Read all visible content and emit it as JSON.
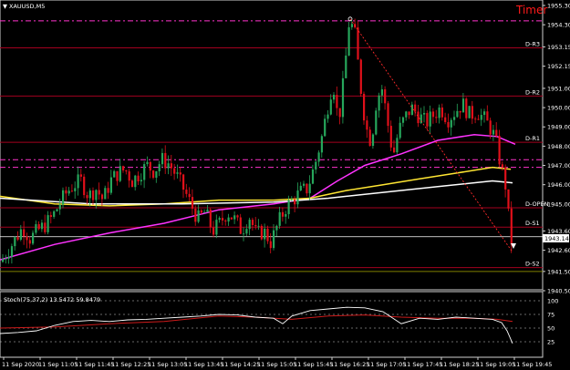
{
  "window": {
    "title": "XAUUSD,M5",
    "timer": "Timer"
  },
  "indicator": {
    "label": "Stoch(75,37,2) 13.5472 59.8479"
  },
  "colors": {
    "bull": "#26a65b",
    "bear": "#e0101a",
    "magenta": "#ff33ff",
    "yellow": "#ffe633",
    "white": "#ffffff",
    "pivot": "#a3001e",
    "dash": "#ff33cc",
    "stoch_main": "#ffffff",
    "stoch_signal": "#cc1a1a",
    "olive": "#808000"
  },
  "chart_data": {
    "type": "candlestick",
    "y_ticks": [
      "1955.30",
      "1954.30",
      "1953.15",
      "1952.15",
      "1951.00",
      "1950.00",
      "1949.00",
      "1948.00",
      "1947.00",
      "1946.00",
      "1945.00",
      "1943.60",
      "1942.60",
      "1941.50",
      "1940.50"
    ],
    "current_price": "1943.14",
    "x_ticks": [
      "11 Sep 2020",
      "11 Sep 11:05",
      "11 Sep 11:45",
      "11 Sep 12:25",
      "11 Sep 13:05",
      "11 Sep 13:45",
      "11 Sep 14:25",
      "11 Sep 15:05",
      "11 Sep 15:45",
      "11 Sep 16:25",
      "11 Sep 17:05",
      "11 Sep 17:45",
      "11 Sep 18:25",
      "11 Sep 19:05",
      "11 Sep 19:45"
    ],
    "pivots": [
      {
        "name": "D-R3",
        "price": 1953.1
      },
      {
        "name": "D-R2",
        "price": 1950.6
      },
      {
        "name": "D-R1",
        "price": 1948.2
      },
      {
        "name": "D-OPEN",
        "price": 1944.8
      },
      {
        "name": "D-S1",
        "price": 1943.8
      },
      {
        "name": "D-S2",
        "price": 1941.7
      }
    ],
    "dashed_levels": [
      1954.5,
      1947.3,
      1946.9
    ],
    "stoch_levels": [
      100,
      75,
      50,
      25
    ],
    "stoch_ticks": [
      "100",
      "75",
      "50",
      "25"
    ]
  }
}
